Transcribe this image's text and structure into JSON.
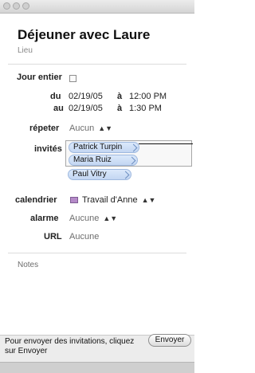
{
  "event": {
    "title": "Déjeuner avec Laure",
    "location_placeholder": "Lieu"
  },
  "allday": {
    "label": "Jour entier",
    "checked": false
  },
  "dates": {
    "from_label": "du",
    "from_date": "02/19/05",
    "from_sep": "à",
    "from_time": "12:00 PM",
    "to_label": "au",
    "to_date": "02/19/05",
    "to_sep": "à",
    "to_time": "1:30 PM"
  },
  "repeat": {
    "label": "répeter",
    "value": "Aucun",
    "stepper": "▲▼"
  },
  "invitees": {
    "label": "invités",
    "items": [
      "Patrick Turpin",
      "Maria Ruiz",
      "Paul Vitry"
    ]
  },
  "calendar": {
    "label": "calendrier",
    "value": "Travail d'Anne",
    "stepper": "▲▼",
    "color": "#b58ac8"
  },
  "alarm": {
    "label": "alarme",
    "value": "Aucune",
    "stepper": "▲▼"
  },
  "url": {
    "label": "URL",
    "value": "Aucune"
  },
  "notes": {
    "placeholder": "Notes"
  },
  "footer": {
    "message": "Pour envoyer des invitations, cliquez sur Envoyer",
    "send_button": "Envoyer"
  }
}
